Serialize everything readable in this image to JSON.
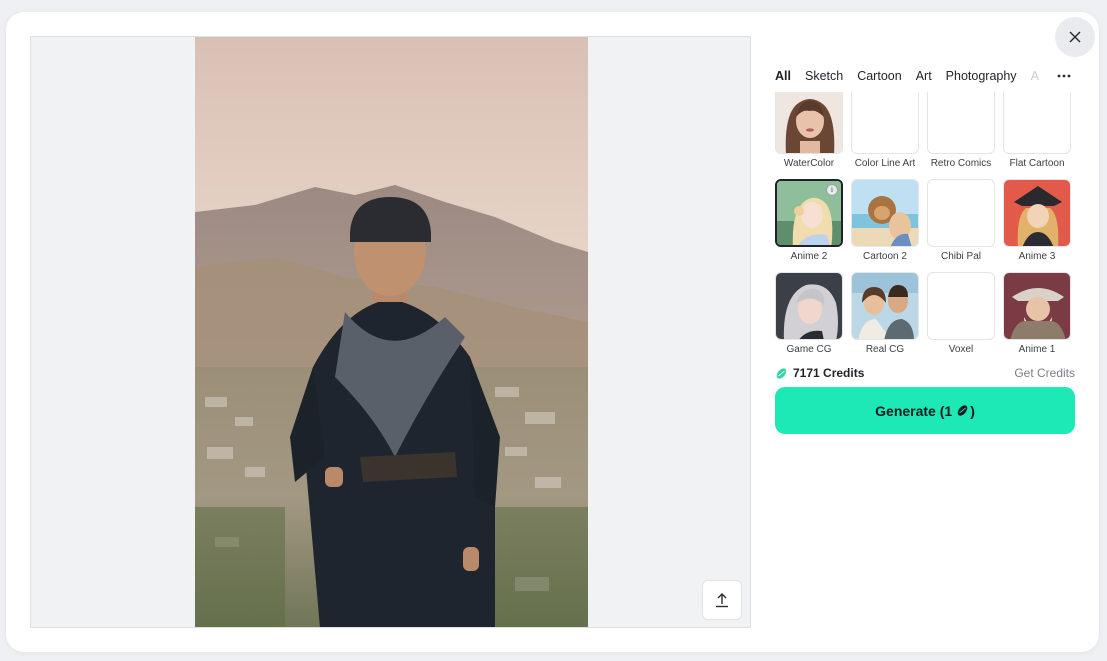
{
  "tabs": [
    {
      "label": "All",
      "active": true
    },
    {
      "label": "Sketch",
      "active": false
    },
    {
      "label": "Cartoon",
      "active": false
    },
    {
      "label": "Art",
      "active": false
    },
    {
      "label": "Photography",
      "active": false
    },
    {
      "label": "A",
      "active": false
    }
  ],
  "styles": [
    {
      "label": "WaterColor",
      "thumb": "portrait-girl"
    },
    {
      "label": "Color Line Art",
      "thumb": "blank"
    },
    {
      "label": "Retro Comics",
      "thumb": "blank"
    },
    {
      "label": "Flat Cartoon",
      "thumb": "blank"
    },
    {
      "label": "Anime 2",
      "thumb": "anime-girl",
      "selected": true
    },
    {
      "label": "Cartoon 2",
      "thumb": "beach-dog"
    },
    {
      "label": "Chibi Pal",
      "thumb": "blank"
    },
    {
      "label": "Anime 3",
      "thumb": "pirate-girl"
    },
    {
      "label": "Game CG",
      "thumb": "dark-hair-girl"
    },
    {
      "label": "Real CG",
      "thumb": "couple"
    },
    {
      "label": "Voxel",
      "thumb": "blank"
    },
    {
      "label": "Anime 1",
      "thumb": "old-man"
    }
  ],
  "credits": {
    "amount_label": "7171 Credits",
    "get_label": "Get Credits",
    "icon": "credit-bean-icon"
  },
  "generate": {
    "label_prefix": "Generate (1",
    "label_suffix": ")",
    "cost_icon": "credit-bean-icon"
  },
  "preview": {
    "image": "boy-in-traditional-clothes-mountain-town-photo"
  },
  "controls": {
    "close_icon": "close-icon",
    "upload_icon": "upload-icon",
    "more_icon": "more-horizontal-icon"
  },
  "colors": {
    "accent": "#1de9b6",
    "credit_icon": "#2fd6a6",
    "text_primary": "#1f2328",
    "text_muted": "#7b8087"
  }
}
